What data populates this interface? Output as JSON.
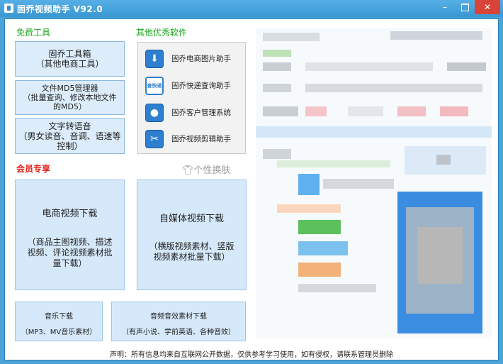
{
  "window": {
    "title": "固乔视频助手 V92.0",
    "minimize": "–",
    "close": "✕"
  },
  "sections": {
    "free_tools": "免费工具",
    "other_software": "其他优秀软件",
    "member": "会员专享",
    "skin": "个性换肤"
  },
  "free_tools": [
    {
      "label": "固乔工具箱\n（其他电商工具）"
    },
    {
      "label": "文件MD5管理器\n（批量查询、修改本地文件\n的MD5）"
    },
    {
      "label": "文字转语音\n（男女读音、音调、语速等\n控制）"
    }
  ],
  "other_software": [
    {
      "label": "固乔电商图片助手",
      "icon": "download-icon",
      "glyph": "⬇"
    },
    {
      "label": "固乔快递查询助手",
      "icon": "express-search-icon",
      "glyph": "查快递"
    },
    {
      "label": "固乔客户管理系统",
      "icon": "customer-icon",
      "glyph": "●"
    },
    {
      "label": "固乔视频剪辑助手",
      "icon": "scissors-icon",
      "glyph": "✂"
    }
  ],
  "member": {
    "ecommerce_video": {
      "title": "电商视频下载",
      "subtitle": "（商品主图视频、描述\n视频、评论视频素材批\n量下载）"
    },
    "media_video": {
      "title": "自媒体视频下载",
      "subtitle": "（横版视频素材、竖版\n视频素材批量下载）"
    },
    "music": {
      "title": "音乐下载",
      "subtitle": "（MP3、MV音乐素材）"
    },
    "audio": {
      "title": "音频音效素材下载",
      "subtitle": "（有声小说、学前英语、各种音效）"
    }
  },
  "footer": "声明：所有信息均来自互联网公开数据，仅供参考学习使用，如有侵权，请联系管理员删除",
  "colors": {
    "titlebar": "#3a97d3",
    "accent_green": "#1aa51a",
    "accent_red": "#e2231a",
    "button_bg": "#dcecfb",
    "close_red": "#d9443a"
  }
}
